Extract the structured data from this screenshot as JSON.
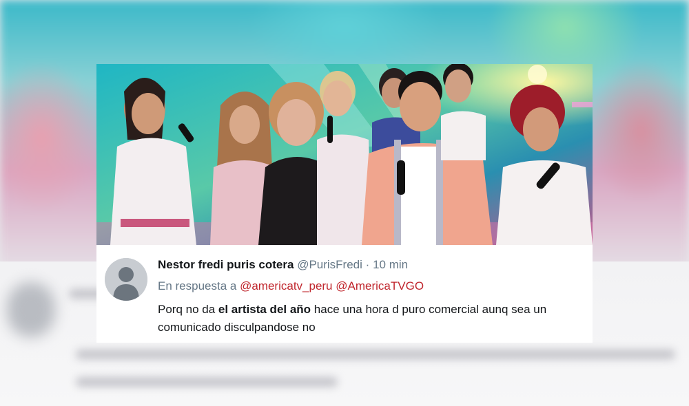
{
  "tweet": {
    "display_name": "Nestor fredi puris cotera",
    "handle": "@PurisFredi",
    "separator": "·",
    "time": "10 min",
    "reply_prefix": "En respuesta a",
    "mentions": [
      "@americatv_peru",
      "@AmericaTVGO"
    ],
    "body_before": "Porq no da ",
    "body_bold": "el artista del año",
    "body_after": " hace una hora d puro comercial aunq sea un comunicado disculpandose no"
  },
  "icons": {
    "avatar": "default-profile-avatar-icon"
  },
  "colors": {
    "mention": "#c0262d",
    "secondary_text": "#657786",
    "primary_text": "#14171a"
  }
}
